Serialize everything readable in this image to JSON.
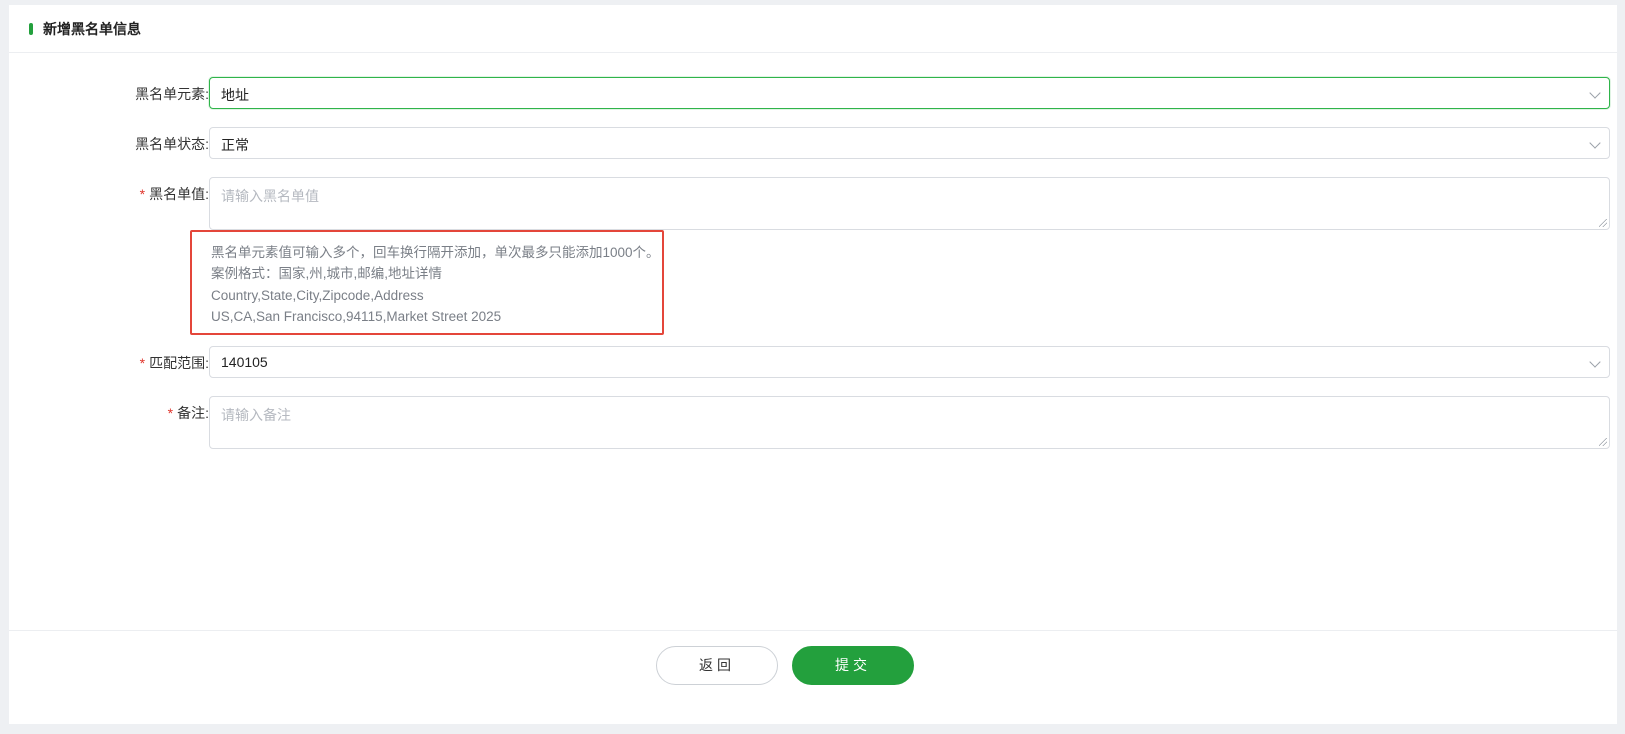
{
  "header": {
    "title": "新增黑名单信息"
  },
  "form": {
    "element": {
      "label": "黑名单元素:",
      "value": "地址",
      "required": false
    },
    "status": {
      "label": "黑名单状态:",
      "value": "正常",
      "required": false
    },
    "value_field": {
      "label": "黑名单值:",
      "placeholder": "请输入黑名单值",
      "required": true
    },
    "hint": {
      "lines": [
        "黑名单元素值可输入多个，回车换行隔开添加，单次最多只能添加1000个。",
        "案例格式：国家,州,城市,邮编,地址详情",
        "Country,State,City,Zipcode,Address",
        "US,CA,San Francisco,94115,Market Street 2025"
      ]
    },
    "range": {
      "label": "匹配范围:",
      "value": "140105",
      "required": true
    },
    "remark": {
      "label": "备注:",
      "placeholder": "请输入备注",
      "required": true
    },
    "required_mark": "*"
  },
  "footer": {
    "back_label": "返回",
    "submit_label": "提交"
  },
  "colors": {
    "accent": "#23a03d",
    "highlight_border": "#e4463a",
    "required": "#e0342b"
  }
}
